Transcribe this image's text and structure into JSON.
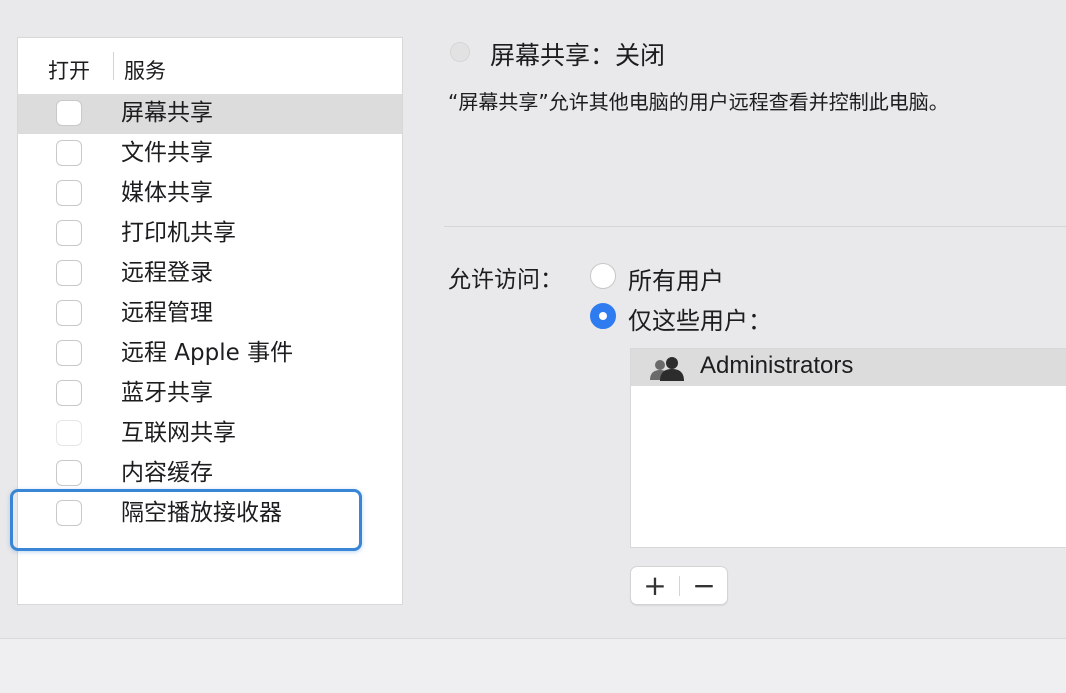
{
  "services_list": {
    "header_open": "打开",
    "header_service": "服务",
    "items": [
      {
        "label": "屏幕共享",
        "checked": false,
        "selected": true,
        "enabled": true
      },
      {
        "label": "文件共享",
        "checked": false,
        "selected": false,
        "enabled": true
      },
      {
        "label": "媒体共享",
        "checked": false,
        "selected": false,
        "enabled": true
      },
      {
        "label": "打印机共享",
        "checked": false,
        "selected": false,
        "enabled": true
      },
      {
        "label": "远程登录",
        "checked": false,
        "selected": false,
        "enabled": true
      },
      {
        "label": "远程管理",
        "checked": false,
        "selected": false,
        "enabled": true
      },
      {
        "label": "远程 Apple 事件",
        "checked": false,
        "selected": false,
        "enabled": true
      },
      {
        "label": "蓝牙共享",
        "checked": false,
        "selected": false,
        "enabled": true
      },
      {
        "label": "互联网共享",
        "checked": false,
        "selected": false,
        "enabled": false
      },
      {
        "label": "内容缓存",
        "checked": false,
        "selected": false,
        "enabled": true
      },
      {
        "label": "隔空播放接收器",
        "checked": false,
        "selected": false,
        "enabled": true
      }
    ]
  },
  "detail": {
    "status": "屏幕共享：关闭",
    "description": "“屏幕共享”允许其他电脑的用户远程查看并控制此电脑。",
    "access_label": "允许访问：",
    "options": {
      "all_users": "所有用户",
      "only_these_users": "仅这些用户："
    },
    "selected_option": "only_these_users",
    "users": [
      {
        "name": "Administrators",
        "icon": "group-icon"
      }
    ],
    "add_button": "+",
    "remove_button": "−"
  },
  "colors": {
    "accent": "#2f7cf0",
    "highlight_border": "#3a86d6",
    "selection": "#dcdcdc"
  }
}
